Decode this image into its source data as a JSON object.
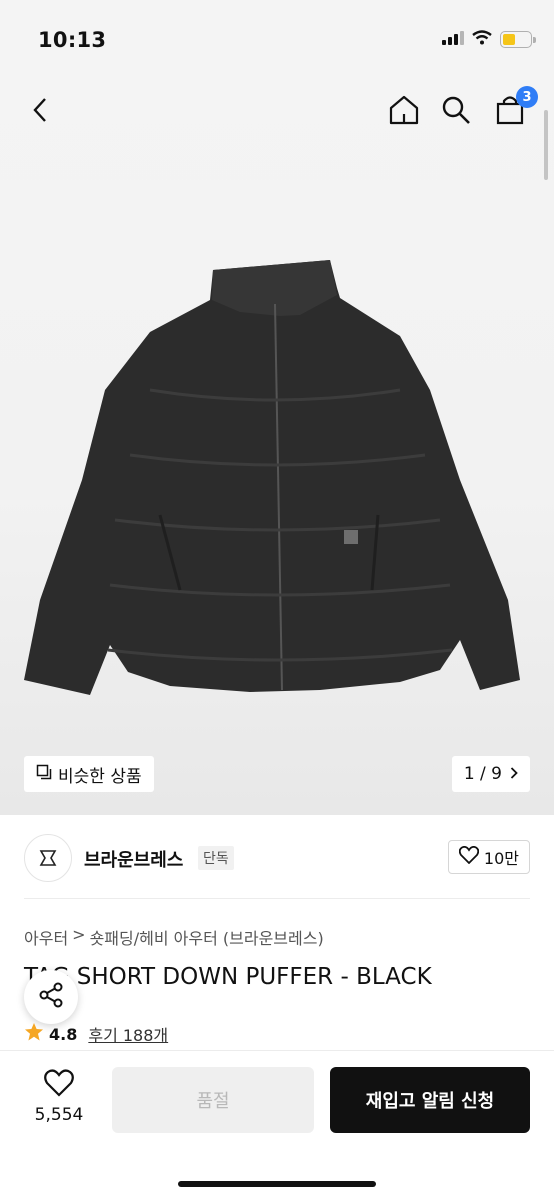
{
  "status": {
    "time": "10:13"
  },
  "nav": {
    "cart_count": "3"
  },
  "gallery": {
    "similar_label": "비슷한 상품",
    "page_indicator": "1 / 9"
  },
  "brand": {
    "name": "브라운브레스",
    "tag": "단독",
    "likes": "10만"
  },
  "product": {
    "breadcrumb_root": "아우터",
    "breadcrumb_sep": ">",
    "breadcrumb_category": "숏패딩/헤비 아우터 (브라운브레스)",
    "title": "TAG SHORT DOWN PUFFER - BLACK",
    "rating": "4.8",
    "reviews": "후기 188개"
  },
  "bottom": {
    "wish_count": "5,554",
    "soldout_label": "품절",
    "restock_label": "재입고 알림 신청"
  },
  "colors": {
    "accent_blue": "#2f7df6",
    "star": "#f5a623",
    "primary": "#111111"
  }
}
